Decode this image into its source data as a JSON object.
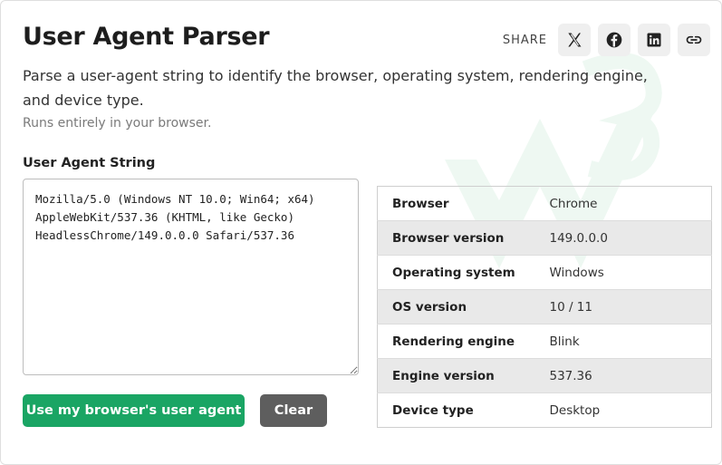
{
  "page": {
    "title": "User Agent Parser",
    "description": "Parse a user-agent string to identify the browser, operating system, rendering engine, and device type.",
    "subtitle": "Runs entirely in your browser."
  },
  "share": {
    "label": "SHARE",
    "buttons": [
      {
        "icon": "x-icon"
      },
      {
        "icon": "facebook-icon"
      },
      {
        "icon": "linkedin-icon"
      },
      {
        "icon": "link-icon"
      }
    ]
  },
  "input": {
    "label": "User Agent String",
    "value": "Mozilla/5.0 (Windows NT 10.0; Win64; x64)\nAppleWebKit/537.36 (KHTML, like Gecko)\nHeadlessChrome/149.0.0.0 Safari/537.36"
  },
  "actions": {
    "use_browser_label": "Use my browser's user agent",
    "clear_label": "Clear"
  },
  "results": [
    {
      "key": "Browser",
      "value": "Chrome"
    },
    {
      "key": "Browser version",
      "value": "149.0.0.0"
    },
    {
      "key": "Operating system",
      "value": "Windows"
    },
    {
      "key": "OS version",
      "value": "10 / 11"
    },
    {
      "key": "Rendering engine",
      "value": "Blink"
    },
    {
      "key": "Engine version",
      "value": "537.36"
    },
    {
      "key": "Device type",
      "value": "Desktop"
    }
  ],
  "colors": {
    "primary": "#1aa564",
    "secondary": "#5e5e5e",
    "row_alt": "#e9e9e9"
  }
}
